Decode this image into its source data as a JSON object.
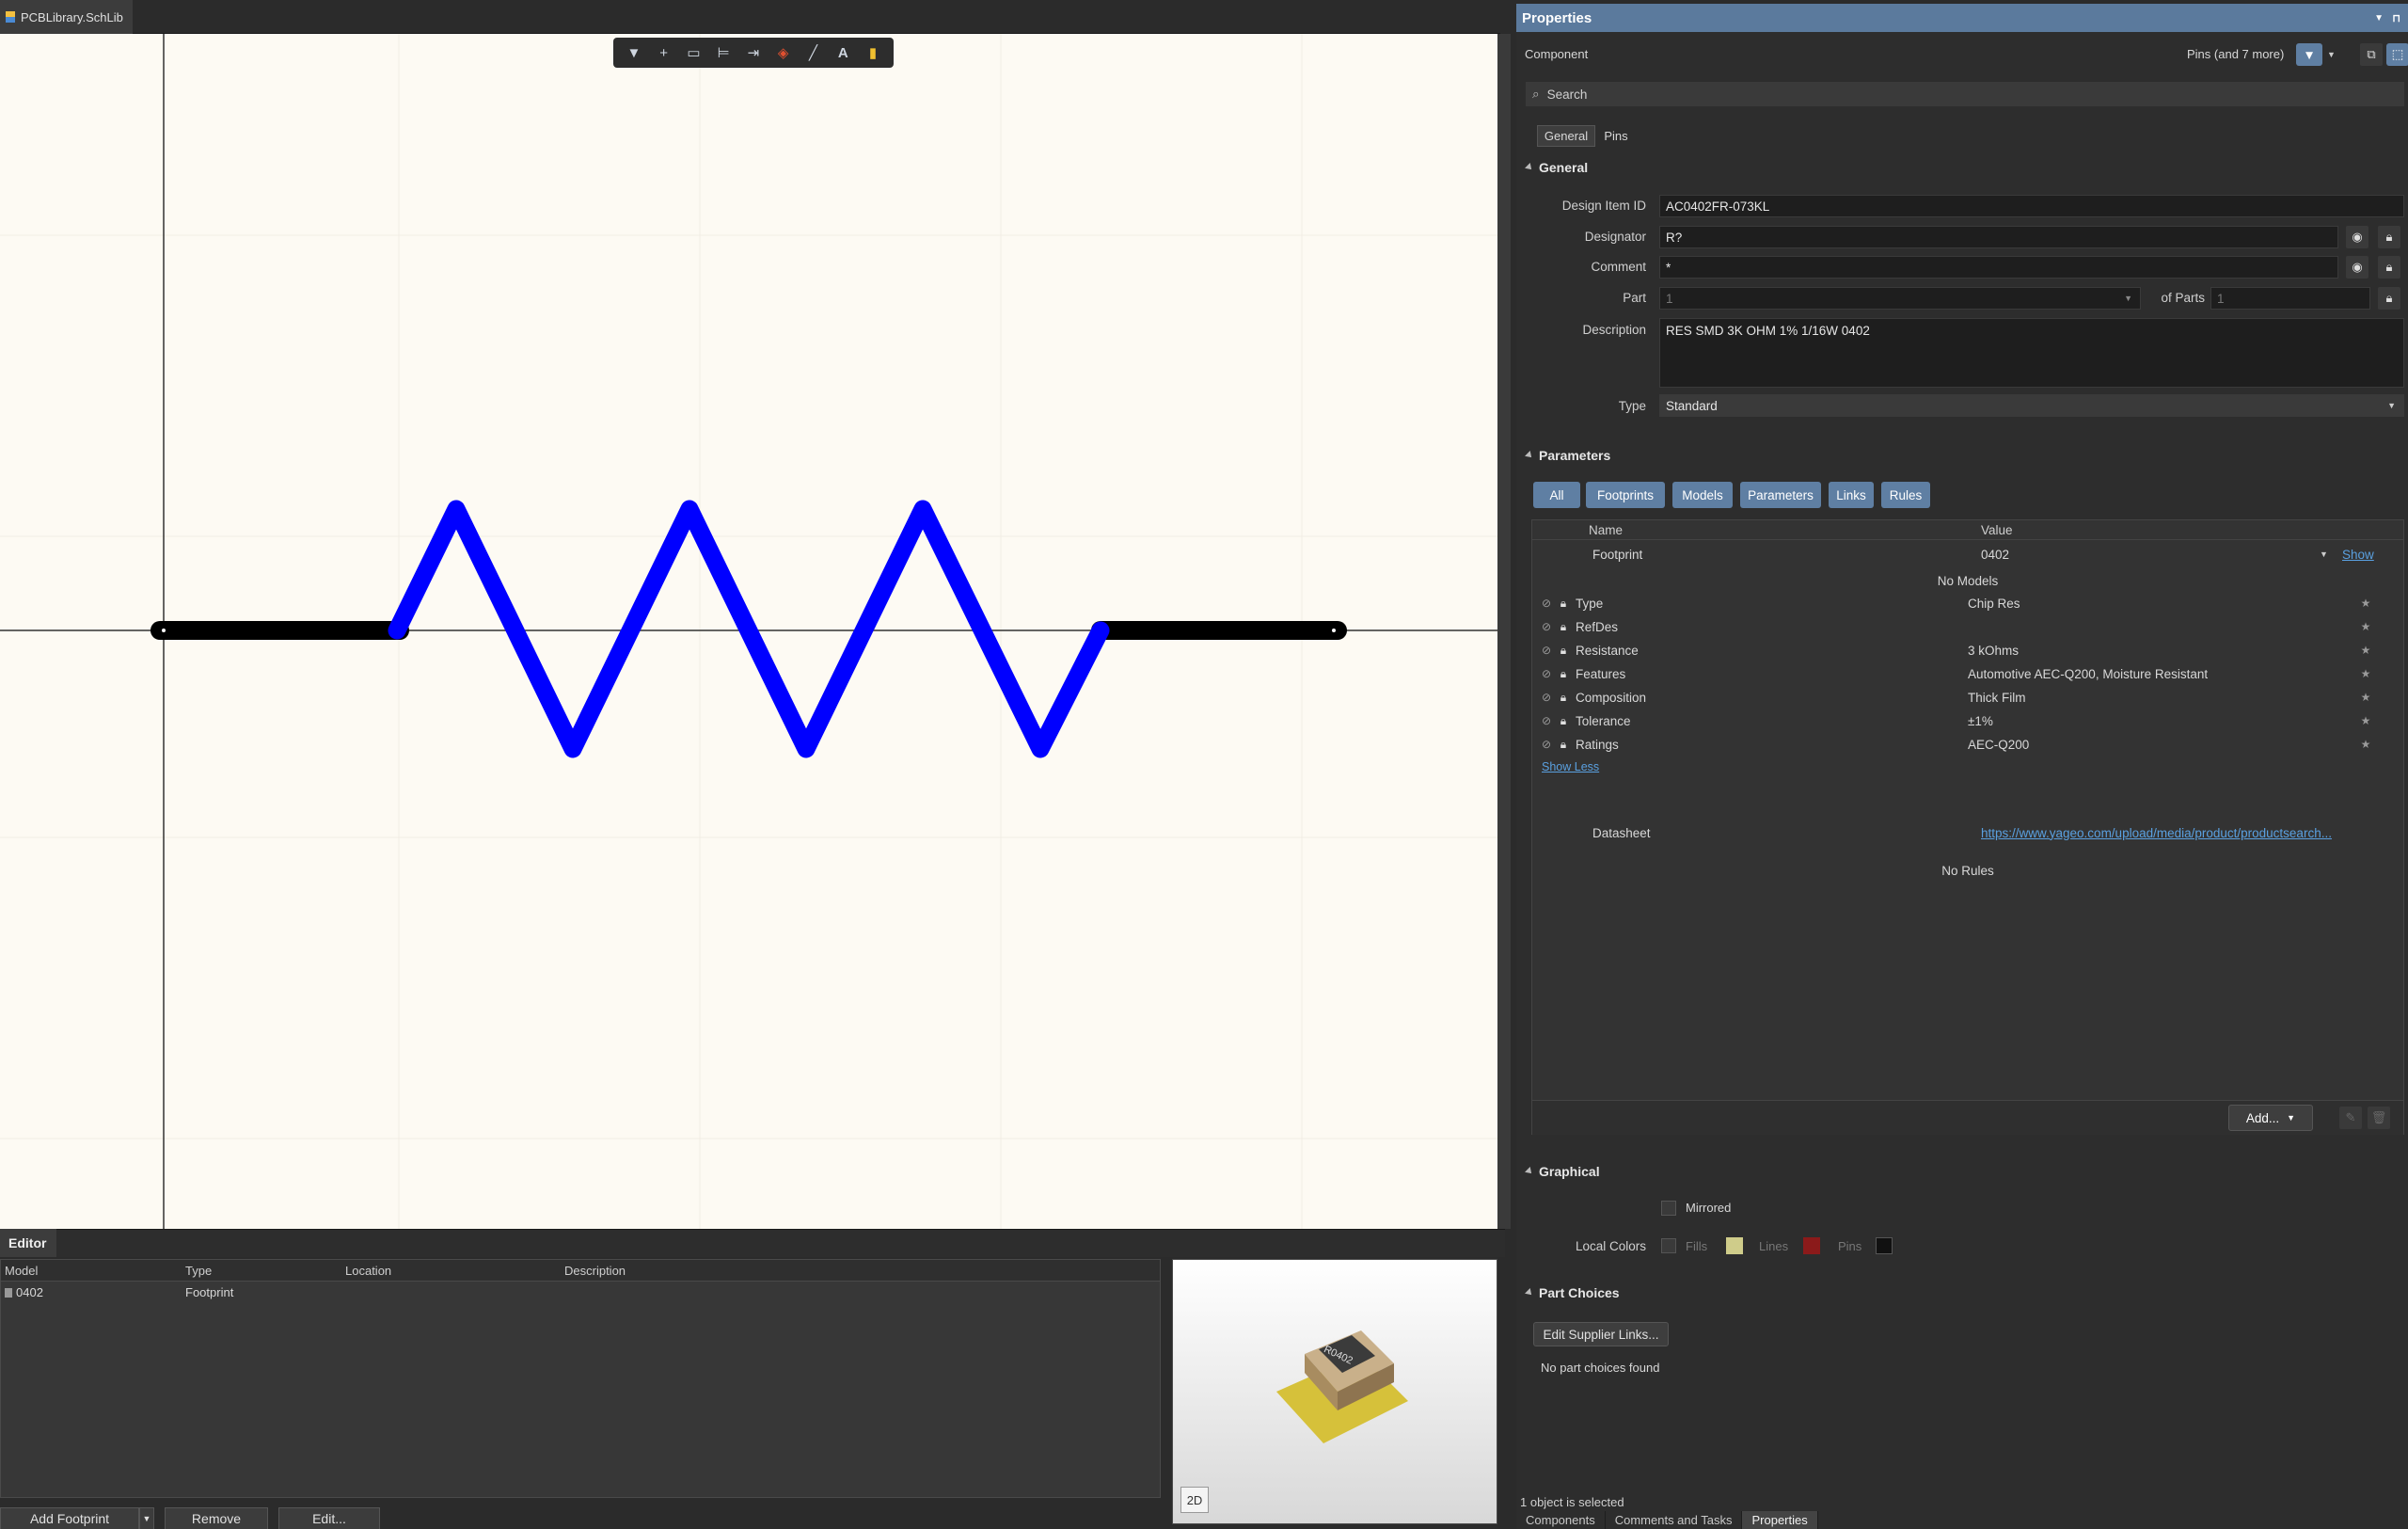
{
  "document": {
    "tab_title": "PCBLibrary.SchLib"
  },
  "canvas_toolbar": {
    "icons": [
      "filter-icon",
      "add-icon",
      "select-rect-icon",
      "align-icon",
      "place-pin-icon",
      "place-icon",
      "line-icon",
      "text-icon",
      "color-icon"
    ]
  },
  "schematic": {
    "component_color": "#0000ff",
    "pin_color": "#000000",
    "background": "#fdfaf3"
  },
  "editor": {
    "tab_label": "Editor",
    "columns": [
      "Model",
      "Type",
      "Location",
      "Description"
    ],
    "rows": [
      {
        "model": "0402",
        "type": "Footprint",
        "location": "",
        "description": ""
      }
    ],
    "buttons": {
      "add_footprint": "Add Footprint",
      "remove": "Remove",
      "edit": "Edit..."
    },
    "view_mode": "2D",
    "preview_label": "R0402"
  },
  "properties": {
    "title": "Properties",
    "object_kind": "Component",
    "filter_summary": "Pins (and 7 more)",
    "search_placeholder": "Search",
    "tabs": [
      "General",
      "Pins"
    ],
    "general": {
      "section_title": "General",
      "design_item_id_label": "Design Item ID",
      "design_item_id": "AC0402FR-073KL",
      "designator_label": "Designator",
      "designator": "R?",
      "comment_label": "Comment",
      "comment": "*",
      "part_label": "Part",
      "part": "1",
      "of_parts_label": "of Parts",
      "of_parts": "1",
      "description_label": "Description",
      "description": "RES SMD 3K OHM 1% 1/16W 0402",
      "type_label": "Type",
      "type": "Standard"
    },
    "parameters": {
      "section_title": "Parameters",
      "filters": [
        "All",
        "Footprints",
        "Models",
        "Parameters",
        "Links",
        "Rules"
      ],
      "col_name": "Name",
      "col_value": "Value",
      "footprint": {
        "name": "Footprint",
        "value": "0402",
        "action": "Show"
      },
      "no_models": "No Models",
      "rows": [
        {
          "name": "Type",
          "value": "Chip Res"
        },
        {
          "name": "RefDes",
          "value": ""
        },
        {
          "name": "Resistance",
          "value": "3 kOhms"
        },
        {
          "name": "Features",
          "value": "Automotive AEC-Q200, Moisture Resistant"
        },
        {
          "name": "Composition",
          "value": "Thick Film"
        },
        {
          "name": "Tolerance",
          "value": "±1%"
        },
        {
          "name": "Ratings",
          "value": "AEC-Q200"
        }
      ],
      "show_less": "Show Less",
      "datasheet": {
        "name": "Datasheet",
        "value": "https://www.yageo.com/upload/media/product/productsearch..."
      },
      "no_rules": "No Rules",
      "add_button": "Add..."
    },
    "graphical": {
      "section_title": "Graphical",
      "mirrored_label": "Mirrored",
      "local_colors_label": "Local Colors",
      "fills_label": "Fills",
      "fills_color": "#cfcc8a",
      "lines_label": "Lines",
      "lines_color": "#8b1a1a",
      "pins_label": "Pins",
      "pins_color": "#111111"
    },
    "part_choices": {
      "section_title": "Part Choices",
      "edit_button": "Edit Supplier Links...",
      "empty_text": "No part choices found"
    }
  },
  "status": {
    "selection": "1 object is selected"
  },
  "panel_tabs": [
    "Components",
    "Comments and Tasks",
    "Properties"
  ]
}
